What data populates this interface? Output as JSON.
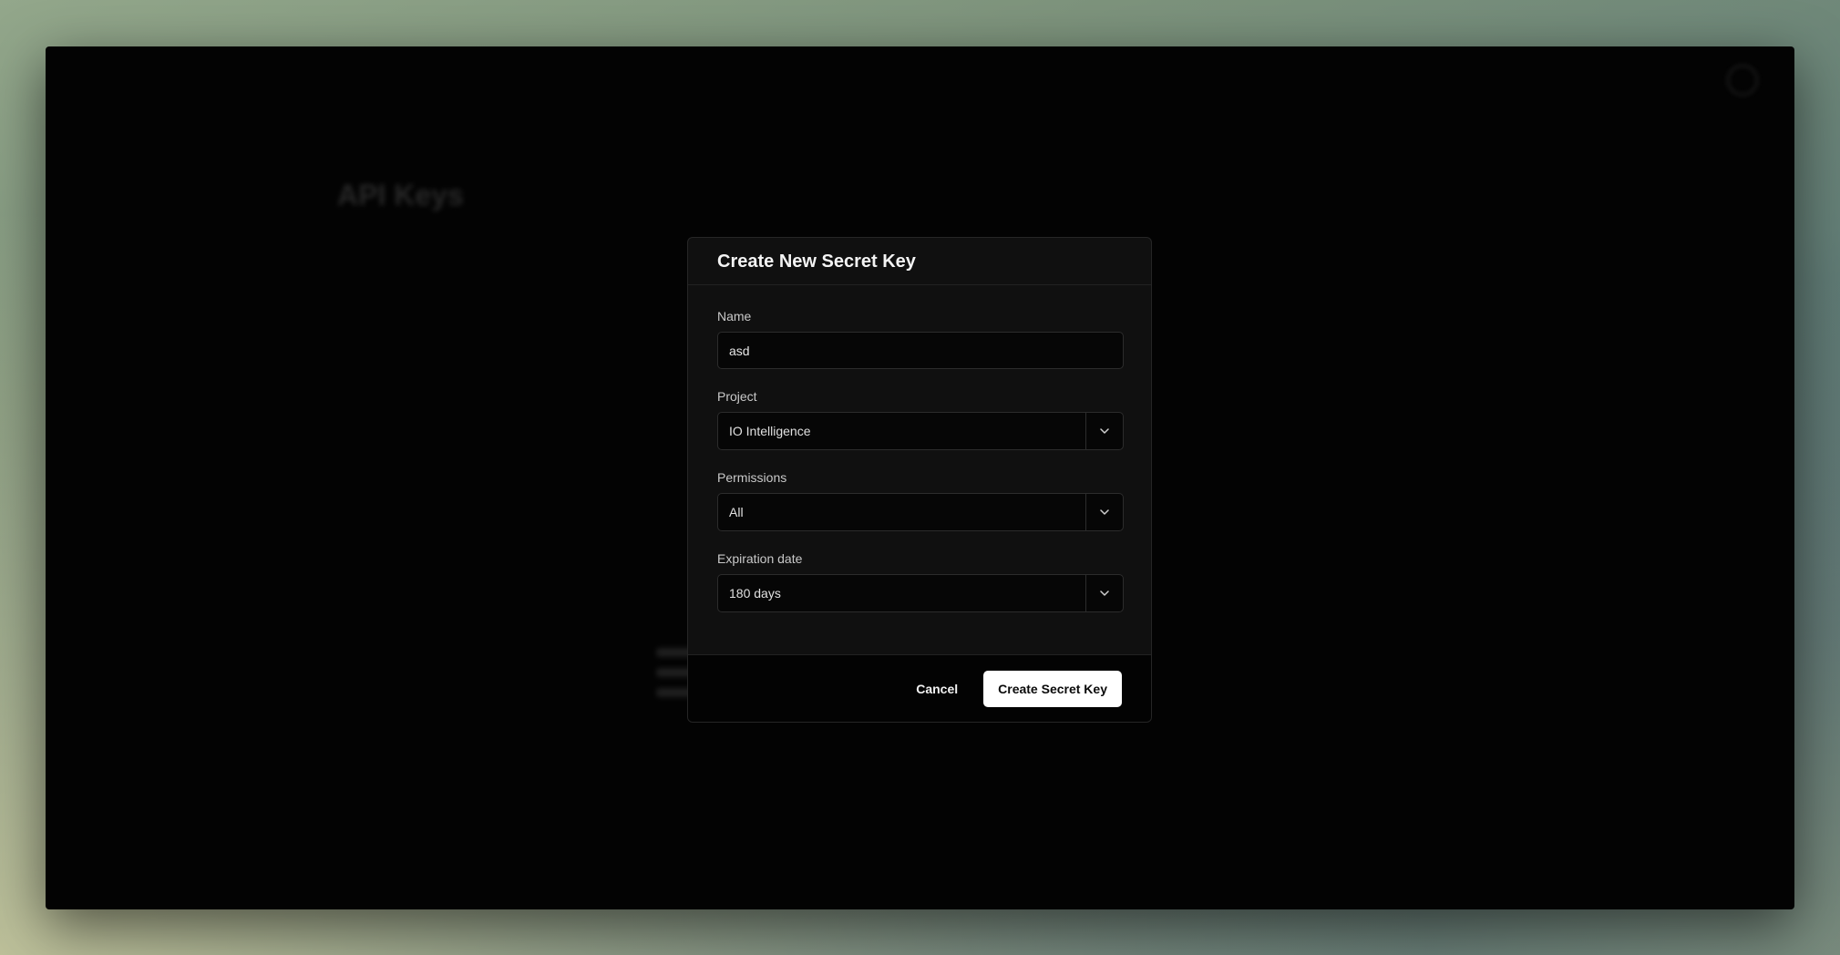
{
  "modal": {
    "title": "Create New Secret Key",
    "fields": {
      "name": {
        "label": "Name",
        "value": "asd",
        "placeholder": ""
      },
      "project": {
        "label": "Project",
        "value": "IO Intelligence"
      },
      "permissions": {
        "label": "Permissions",
        "value": "All"
      },
      "expiration": {
        "label": "Expiration date",
        "value": "180 days"
      }
    },
    "cancel_label": "Cancel",
    "submit_label": "Create Secret Key"
  },
  "background": {
    "page_title": "API Keys"
  },
  "colors": {
    "modal_bg": "#101010",
    "window_bg": "#030303",
    "primary_button_bg": "#ffffff",
    "primary_button_text": "#0a0a0a"
  },
  "icons": {
    "select_toggle": "chevron-down-icon"
  }
}
